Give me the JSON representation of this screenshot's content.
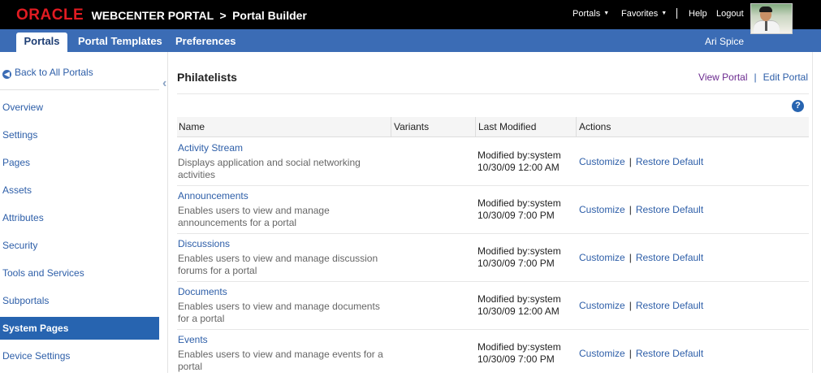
{
  "header": {
    "oracle": "ORACLE",
    "product": "WEBCENTER PORTAL",
    "separator": ">",
    "app": "Portal Builder",
    "links": {
      "portals": "Portals",
      "favorites": "Favorites",
      "help": "Help",
      "logout": "Logout"
    }
  },
  "tabs": {
    "portals": "Portals",
    "templates": "Portal Templates",
    "preferences": "Preferences",
    "user": "Ari Spice"
  },
  "sidebar": {
    "back": "Back to All Portals",
    "items": [
      "Overview",
      "Settings",
      "Pages",
      "Assets",
      "Attributes",
      "Security",
      "Tools and Services",
      "Subportals",
      "System Pages",
      "Device Settings"
    ],
    "active": "System Pages"
  },
  "main": {
    "title": "Philatelists",
    "view_portal": "View Portal",
    "pipe": "|",
    "edit_portal": "Edit Portal",
    "help_icon": "?",
    "columns": {
      "name": "Name",
      "variants": "Variants",
      "last_modified": "Last Modified",
      "actions": "Actions"
    },
    "action_labels": {
      "customize": "Customize",
      "separator": "|",
      "restore": "Restore Default"
    },
    "rows": [
      {
        "name": "Activity Stream",
        "desc": "Displays application and social networking activities",
        "modified_by": "Modified by:system",
        "modified_at": "10/30/09 12:00 AM"
      },
      {
        "name": "Announcements",
        "desc": "Enables users to view and manage announcements for a portal",
        "modified_by": "Modified by:system",
        "modified_at": "10/30/09 7:00 PM"
      },
      {
        "name": "Discussions",
        "desc": "Enables users to view and manage discussion forums for a portal",
        "modified_by": "Modified by:system",
        "modified_at": "10/30/09 7:00 PM"
      },
      {
        "name": "Documents",
        "desc": "Enables users to view and manage documents for a portal",
        "modified_by": "Modified by:system",
        "modified_at": "10/30/09 12:00 AM"
      },
      {
        "name": "Events",
        "desc": "Enables users to view and manage events for a portal",
        "modified_by": "Modified by:system",
        "modified_at": "10/30/09 7:00 PM"
      }
    ]
  },
  "colors": {
    "topbar": "#000000",
    "oracle_red": "#e11b22",
    "tabbar": "#3b6cb5",
    "active_nav": "#2764b0",
    "link": "#2d5ea8",
    "visited_link": "#6b2a8f"
  },
  "icons": {
    "back": "back-arrow-circle-icon",
    "collapse": "collapse-left-icon",
    "help": "help-question-icon",
    "dropdown": "caret-down-icon",
    "avatar": "user-avatar"
  }
}
